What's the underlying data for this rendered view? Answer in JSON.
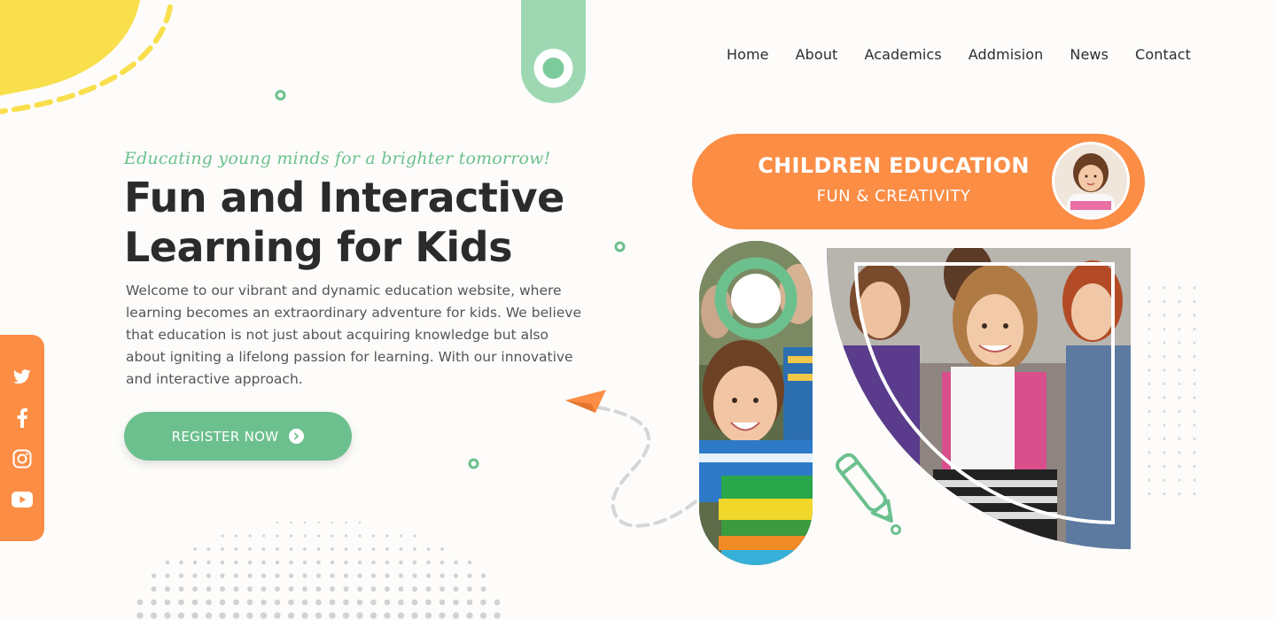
{
  "nav": {
    "items": [
      "Home",
      "About",
      "Academics",
      "Addmision",
      "News",
      "Contact"
    ]
  },
  "hero": {
    "tagline": "Educating young minds for a brighter tomorrow!",
    "title_line1": "Fun and Interactive",
    "title_line2": "Learning for Kids",
    "description": "Welcome to our vibrant and dynamic education website, where learning becomes an extraordinary adventure for kids. We believe that education is not just about acquiring knowledge but also about igniting a lifelong passion for learning. With our innovative and interactive approach.",
    "button_label": "REGISTER NOW"
  },
  "banner": {
    "title": "CHILDREN EDUCATION",
    "subtitle": "FUN & CREATIVITY"
  },
  "social": {
    "icons": [
      "twitter-icon",
      "facebook-icon",
      "instagram-icon",
      "youtube-icon"
    ]
  },
  "colors": {
    "accent_green": "#6cc08e",
    "accent_orange": "#fb8d45",
    "accent_yellow": "#f9df4c",
    "text_dark": "#2b2b2b",
    "background": "#fdfcfa"
  }
}
